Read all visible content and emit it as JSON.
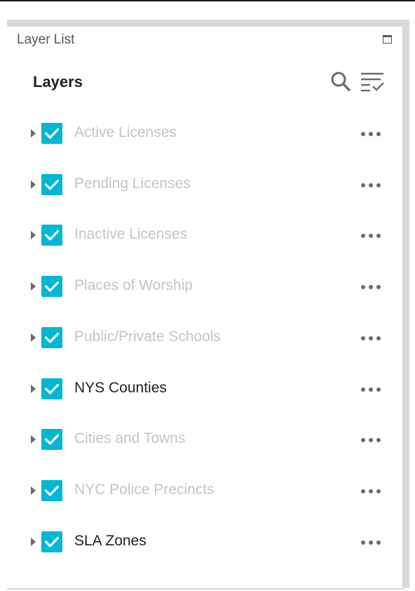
{
  "panel": {
    "title": "Layer List",
    "heading": "Layers"
  },
  "icons": {
    "maximize": "maximize-icon",
    "search": "search-icon",
    "filter": "filter-list-icon",
    "expand": "caret-right-icon",
    "checkbox": "checkbox-checked-icon",
    "more": "more-horizontal-icon"
  },
  "colors": {
    "checkbox": "#00b7d6",
    "label_active": "#1f1f1f",
    "label_dim": "#c4c4c4"
  },
  "layers": [
    {
      "label": "Active Licenses",
      "checked": true,
      "dimmed": true
    },
    {
      "label": "Pending Licenses",
      "checked": true,
      "dimmed": true
    },
    {
      "label": "Inactive Licenses",
      "checked": true,
      "dimmed": true
    },
    {
      "label": "Places of Worship",
      "checked": true,
      "dimmed": true
    },
    {
      "label": "Public/Private Schools",
      "checked": true,
      "dimmed": true
    },
    {
      "label": "NYS Counties",
      "checked": true,
      "dimmed": false
    },
    {
      "label": "Cities and Towns",
      "checked": true,
      "dimmed": true
    },
    {
      "label": "NYC Police Precincts",
      "checked": true,
      "dimmed": true
    },
    {
      "label": "SLA Zones",
      "checked": true,
      "dimmed": false
    }
  ]
}
